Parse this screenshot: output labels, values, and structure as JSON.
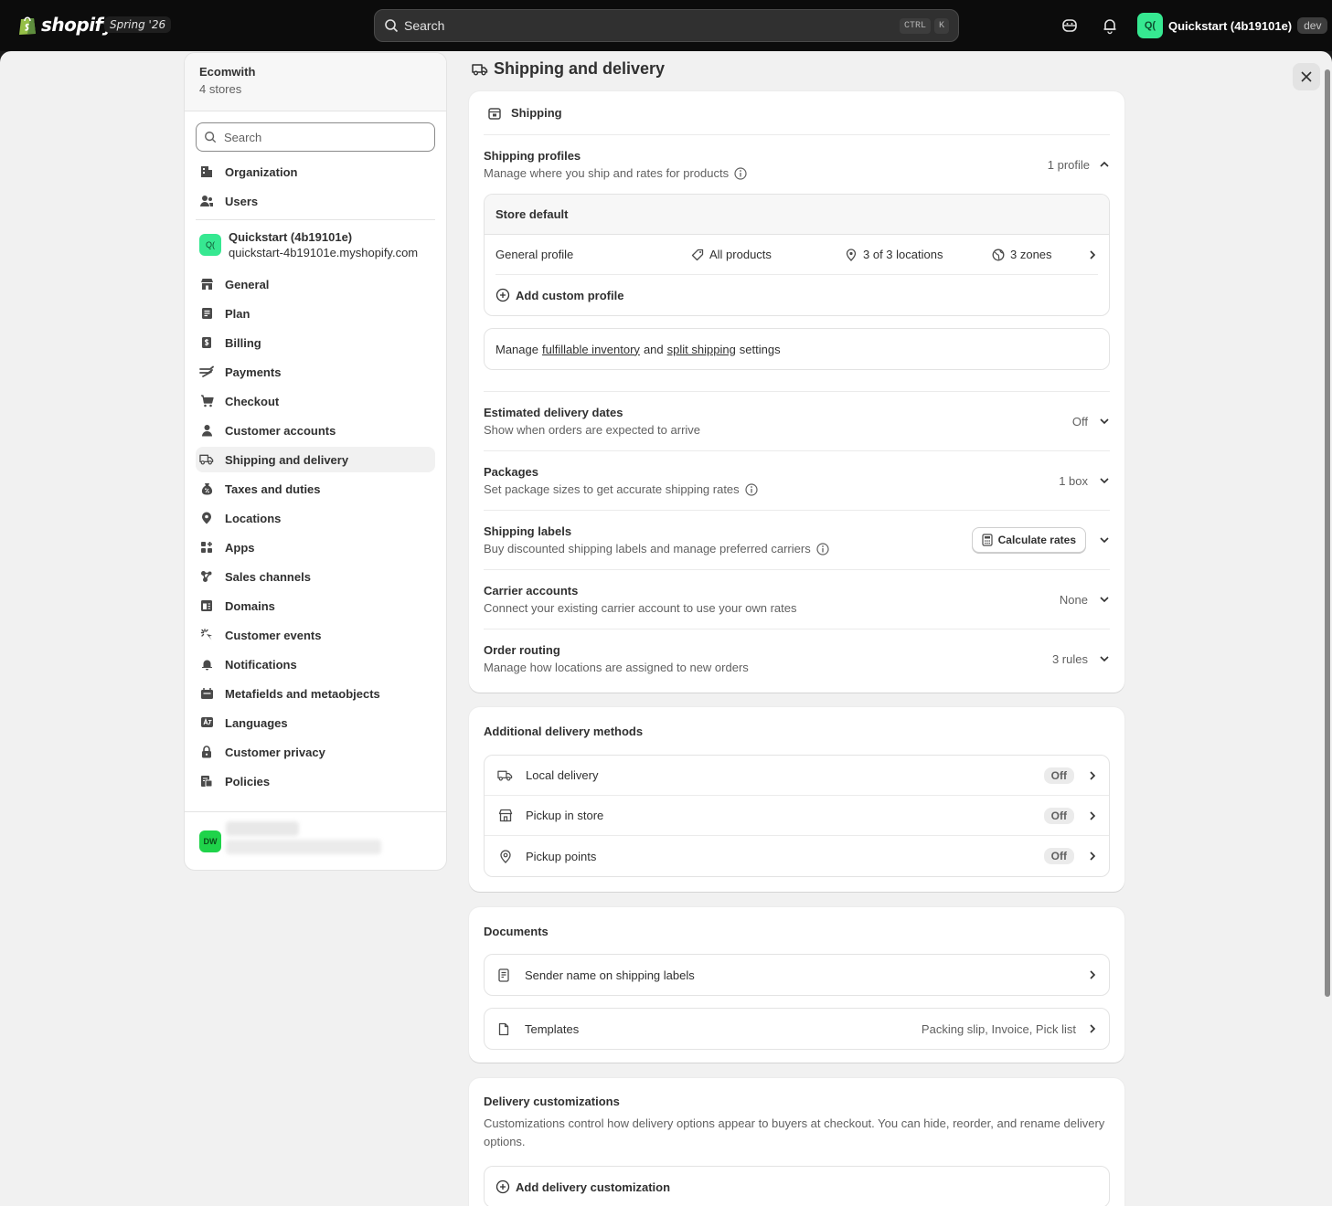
{
  "topbar": {
    "brand": "shopify",
    "edition": "Spring '26",
    "search_placeholder": "Search",
    "shortcut_mod": "CTRL",
    "shortcut_key": "K",
    "store_avatar": "Q(",
    "store_name": "Quickstart (4b19101e)",
    "env_badge": "dev"
  },
  "sidebar": {
    "org_name": "Ecomwith",
    "org_sub": "4 stores",
    "search_placeholder": "Search",
    "org_items": [
      {
        "label": "Organization",
        "icon": "organization-icon"
      },
      {
        "label": "Users",
        "icon": "users-icon"
      }
    ],
    "store": {
      "avatar": "Q(",
      "name": "Quickstart (4b19101e)",
      "url": "quickstart-4b19101e.myshopify.com"
    },
    "items": [
      {
        "label": "General",
        "icon": "store-icon"
      },
      {
        "label": "Plan",
        "icon": "plan-icon"
      },
      {
        "label": "Billing",
        "icon": "billing-icon"
      },
      {
        "label": "Payments",
        "icon": "payments-icon"
      },
      {
        "label": "Checkout",
        "icon": "cart-icon"
      },
      {
        "label": "Customer accounts",
        "icon": "person-icon"
      },
      {
        "label": "Shipping and delivery",
        "icon": "truck-icon",
        "active": true
      },
      {
        "label": "Taxes and duties",
        "icon": "tax-icon"
      },
      {
        "label": "Locations",
        "icon": "location-icon"
      },
      {
        "label": "Apps",
        "icon": "apps-icon"
      },
      {
        "label": "Sales channels",
        "icon": "channels-icon"
      },
      {
        "label": "Domains",
        "icon": "domains-icon"
      },
      {
        "label": "Customer events",
        "icon": "events-icon"
      },
      {
        "label": "Notifications",
        "icon": "bell-icon"
      },
      {
        "label": "Metafields and metaobjects",
        "icon": "metafields-icon"
      },
      {
        "label": "Languages",
        "icon": "languages-icon"
      },
      {
        "label": "Customer privacy",
        "icon": "lock-icon"
      },
      {
        "label": "Policies",
        "icon": "policies-icon"
      }
    ],
    "footer_avatar": "DW"
  },
  "page": {
    "title": "Shipping and delivery"
  },
  "shipping_card": {
    "header": "Shipping",
    "profiles": {
      "title": "Shipping profiles",
      "subtitle": "Manage where you ship and rates for products",
      "value": "1 profile",
      "store_default": "Store default",
      "general_profile": "General profile",
      "products": "All products",
      "locations": "3 of 3 locations",
      "zones": "3 zones",
      "add_custom": "Add custom profile"
    },
    "manage": {
      "prefix": "Manage",
      "link1": "fulfillable inventory",
      "middle": "and",
      "link2": "split shipping",
      "suffix": "settings"
    },
    "rows": [
      {
        "title": "Estimated delivery dates",
        "subtitle": "Show when orders are expected to arrive",
        "value": "Off",
        "info": false
      },
      {
        "title": "Packages",
        "subtitle": "Set package sizes to get accurate shipping rates",
        "value": "1 box",
        "info": true
      },
      {
        "title": "Shipping labels",
        "subtitle": "Buy discounted shipping labels and manage preferred carriers",
        "button": "Calculate rates",
        "info": true
      },
      {
        "title": "Carrier accounts",
        "subtitle": "Connect your existing carrier account to use your own rates",
        "value": "None",
        "info": false
      },
      {
        "title": "Order routing",
        "subtitle": "Manage how locations are assigned to new orders",
        "value": "3 rules",
        "info": false
      }
    ]
  },
  "additional": {
    "title": "Additional delivery methods",
    "items": [
      {
        "label": "Local delivery",
        "status": "Off",
        "icon": "truck-icon"
      },
      {
        "label": "Pickup in store",
        "status": "Off",
        "icon": "store-icon"
      },
      {
        "label": "Pickup points",
        "status": "Off",
        "icon": "location-icon"
      }
    ]
  },
  "documents": {
    "title": "Documents",
    "sender": "Sender name on shipping labels",
    "templates": "Templates",
    "templates_value": "Packing slip, Invoice, Pick list"
  },
  "customizations": {
    "title": "Delivery customizations",
    "description": "Customizations control how delivery options appear to buyers at checkout. You can hide, reorder, and rename delivery options.",
    "add": "Add delivery customization"
  }
}
